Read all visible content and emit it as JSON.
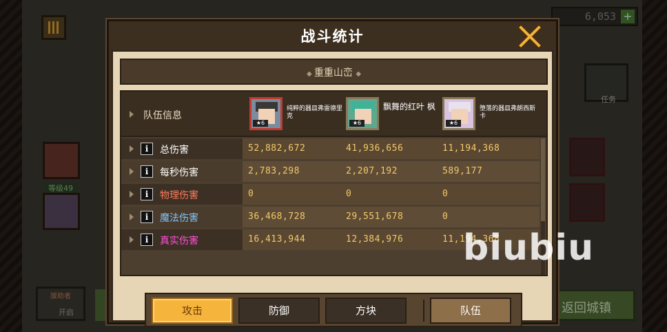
{
  "background": {
    "currency_value": "6,053",
    "currency_plus": "+",
    "level_badge": "等级49",
    "task_label": "任务",
    "help_label": "援助者",
    "help_open": "开启",
    "return_label": "返回城镇"
  },
  "dialog": {
    "title": "战斗统计",
    "stage_name": "重重山峦",
    "header_label": "队伍信息",
    "heroes": [
      {
        "name": "纯粹的器皿弗雷德里克",
        "stars": "6"
      },
      {
        "name": "飘舞的红叶 枫",
        "stars": "6"
      },
      {
        "name": "堕落的器皿弗朗西斯卡",
        "stars": "6"
      }
    ],
    "rows": [
      {
        "label": "总伤害",
        "color": "#ffffff",
        "values": [
          "52,882,672",
          "41,936,656",
          "11,194,368"
        ]
      },
      {
        "label": "每秒伤害",
        "color": "#ffffff",
        "values": [
          "2,783,298",
          "2,207,192",
          "589,177"
        ]
      },
      {
        "label": "物理伤害",
        "color": "#ff7b5c",
        "values": [
          "0",
          "0",
          "0"
        ]
      },
      {
        "label": "魔法伤害",
        "color": "#7fc4ff",
        "values": [
          "36,468,728",
          "29,551,678",
          "0"
        ]
      },
      {
        "label": "真实伤害",
        "color": "#ff4fd6",
        "values": [
          "16,413,944",
          "12,384,976",
          "11,194,368"
        ]
      }
    ],
    "tabs": {
      "attack": "攻击",
      "defense": "防御",
      "block": "方块",
      "team": "队伍"
    }
  },
  "watermark": "biubiu",
  "colors": {
    "accent": "#f5b43c",
    "value": "#f2c96a"
  }
}
